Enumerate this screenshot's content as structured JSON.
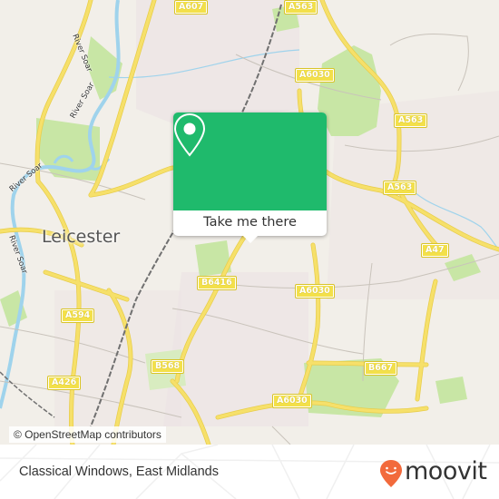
{
  "map": {
    "city_label": "Leicester",
    "river_labels": [
      "River Soar",
      "River Soar",
      "River Soar",
      "River Soar"
    ],
    "road_shields": [
      {
        "label": "A607"
      },
      {
        "label": "A563"
      },
      {
        "label": "A6030"
      },
      {
        "label": "A563"
      },
      {
        "label": "A563"
      },
      {
        "label": "A47"
      },
      {
        "label": "B6416"
      },
      {
        "label": "A6030"
      },
      {
        "label": "A594"
      },
      {
        "label": "B568"
      },
      {
        "label": "B667"
      },
      {
        "label": "A426"
      },
      {
        "label": "A6030"
      }
    ],
    "attribution": "© OpenStreetMap contributors",
    "colors": {
      "background": "#f2efe9",
      "park": "#c8e6a5",
      "water": "#9fd3ec",
      "road": "#f6e06a",
      "shield": "#f3e04a",
      "rail": "#707070"
    }
  },
  "popup": {
    "icon": "map-pin-icon",
    "button_label": "Take me there",
    "accent_color": "#1fba6c"
  },
  "footer": {
    "place_name": "Classical Windows, East Midlands",
    "brand": "moovit",
    "brand_color": "#f26a3c"
  }
}
